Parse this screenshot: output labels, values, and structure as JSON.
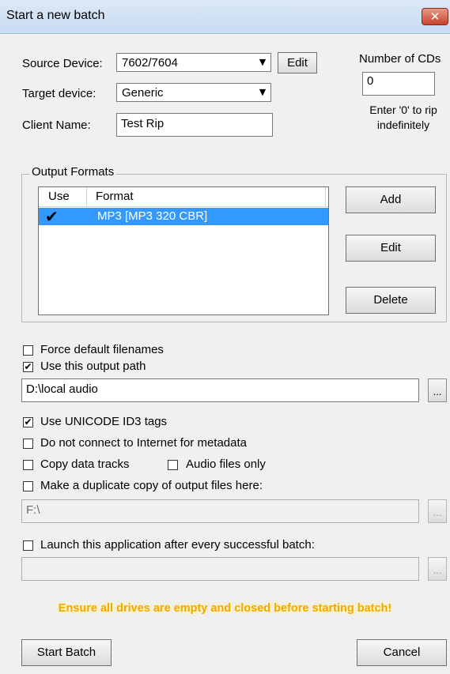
{
  "window": {
    "title": "Start a new batch",
    "close_glyph": "✕"
  },
  "source": {
    "label": "Source Device:",
    "value": "7602/7604",
    "edit_label": "Edit"
  },
  "target": {
    "label": "Target device:",
    "value": "Generic"
  },
  "client": {
    "label": "Client Name:",
    "value": "Test Rip"
  },
  "num_cds": {
    "label": "Number of CDs",
    "value": "0",
    "hint_line1": "Enter '0' to rip",
    "hint_line2": "indefinitely"
  },
  "output_formats": {
    "group_title": "Output Formats",
    "columns": [
      "Use",
      "Format"
    ],
    "rows": [
      {
        "use": true,
        "format": "MP3 [MP3 320 CBR]"
      }
    ],
    "add_label": "Add",
    "edit_label": "Edit",
    "delete_label": "Delete"
  },
  "options": {
    "force_default_filenames": {
      "label": "Force default filenames",
      "checked": false
    },
    "use_output_path": {
      "label": "Use this output path",
      "checked": true
    },
    "output_path": "D:\\local audio",
    "unicode_id3": {
      "label": "Use UNICODE ID3 tags",
      "checked": true
    },
    "no_internet": {
      "label": "Do not connect to Internet for metadata",
      "checked": false
    },
    "copy_data_tracks": {
      "label": "Copy data tracks",
      "checked": false
    },
    "audio_files_only": {
      "label": "Audio files only",
      "checked": false
    },
    "duplicate_copy": {
      "label": "Make a duplicate copy of output files here:",
      "checked": false
    },
    "duplicate_path": "F:\\",
    "launch_app": {
      "label": "Launch this application after every successful batch:",
      "checked": false
    },
    "launch_path": "",
    "browse_label": "..."
  },
  "warning": "Ensure all drives are empty and closed before starting batch!",
  "footer": {
    "start_label": "Start Batch",
    "cancel_label": "Cancel"
  },
  "icons": {
    "combo_arrow": "▼",
    "check": "✔"
  }
}
